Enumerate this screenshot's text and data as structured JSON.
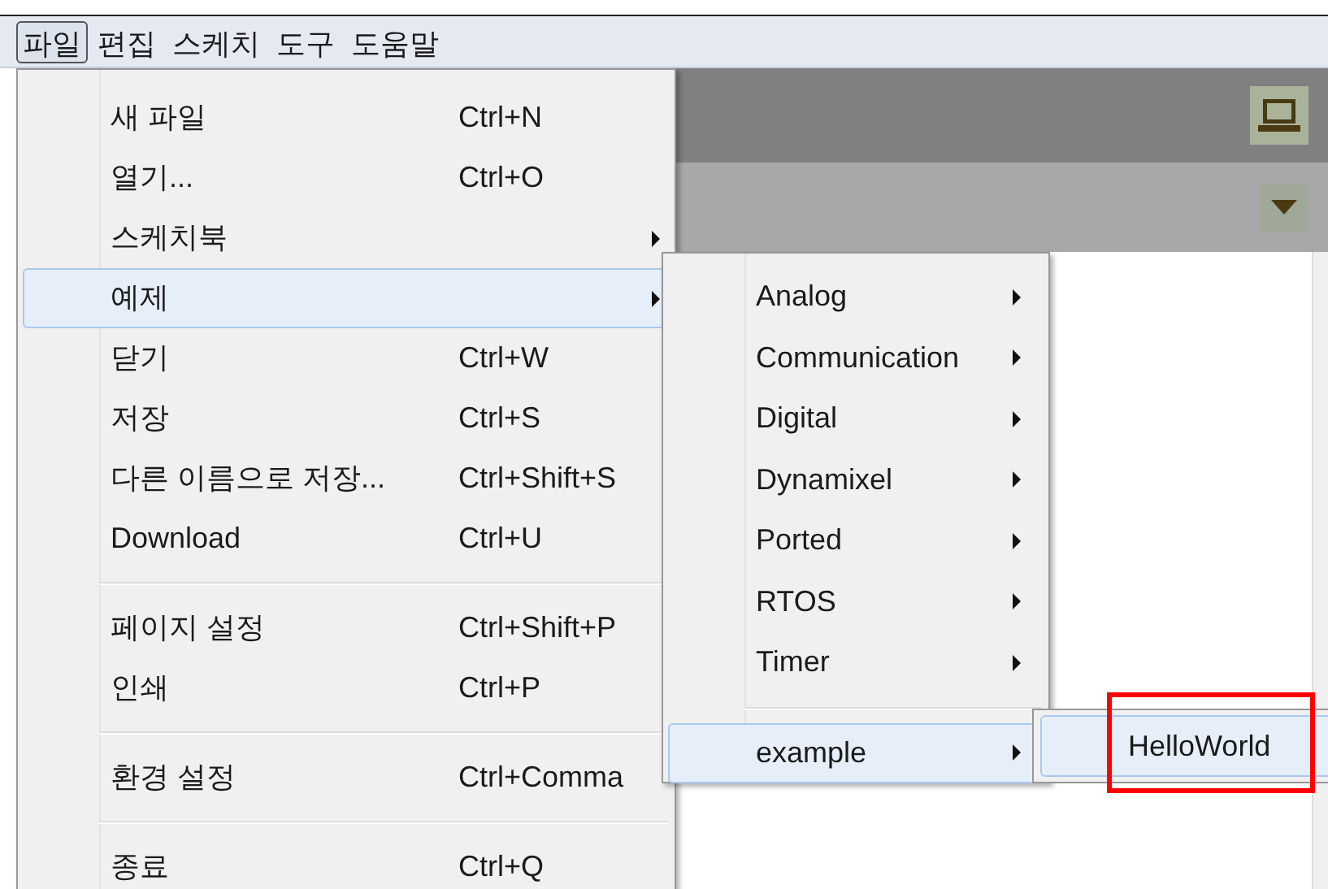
{
  "menubar": [
    {
      "label": "파일",
      "selected": true
    },
    {
      "label": "편집",
      "selected": false
    },
    {
      "label": "스케치",
      "selected": false
    },
    {
      "label": "도구",
      "selected": false
    },
    {
      "label": "도움말",
      "selected": false
    }
  ],
  "file_menu": [
    {
      "kind": "item",
      "label": "새 파일",
      "shortcut": "Ctrl+N",
      "has_submenu": false,
      "selected": false
    },
    {
      "kind": "item",
      "label": "열기...",
      "shortcut": "Ctrl+O",
      "has_submenu": false,
      "selected": false
    },
    {
      "kind": "item",
      "label": "스케치북",
      "has_submenu": true,
      "selected": false
    },
    {
      "kind": "item",
      "label": "예제",
      "has_submenu": true,
      "selected": true
    },
    {
      "kind": "item",
      "label": "닫기",
      "shortcut": "Ctrl+W",
      "has_submenu": false,
      "selected": false
    },
    {
      "kind": "item",
      "label": "저장",
      "shortcut": "Ctrl+S",
      "has_submenu": false,
      "selected": false
    },
    {
      "kind": "item",
      "label": "다른 이름으로 저장...",
      "shortcut": "Ctrl+Shift+S",
      "has_submenu": false,
      "selected": false
    },
    {
      "kind": "item",
      "label": "Download",
      "shortcut": "Ctrl+U",
      "has_submenu": false,
      "selected": false
    },
    {
      "kind": "separator"
    },
    {
      "kind": "item",
      "label": "페이지 설정",
      "shortcut": "Ctrl+Shift+P",
      "has_submenu": false,
      "selected": false
    },
    {
      "kind": "item",
      "label": "인쇄",
      "shortcut": "Ctrl+P",
      "has_submenu": false,
      "selected": false
    },
    {
      "kind": "separator"
    },
    {
      "kind": "item",
      "label": "환경 설정",
      "shortcut": "Ctrl+Comma",
      "has_submenu": false,
      "selected": false
    },
    {
      "kind": "separator"
    },
    {
      "kind": "item",
      "label": "종료",
      "shortcut": "Ctrl+Q",
      "has_submenu": false,
      "selected": false
    }
  ],
  "examples_menu": [
    {
      "kind": "item",
      "label": "Analog",
      "has_submenu": true,
      "selected": false
    },
    {
      "kind": "item",
      "label": "Communication",
      "has_submenu": true,
      "selected": false
    },
    {
      "kind": "item",
      "label": "Digital",
      "has_submenu": true,
      "selected": false
    },
    {
      "kind": "item",
      "label": "Dynamixel",
      "has_submenu": true,
      "selected": false
    },
    {
      "kind": "item",
      "label": "Ported",
      "has_submenu": true,
      "selected": false
    },
    {
      "kind": "item",
      "label": "RTOS",
      "has_submenu": true,
      "selected": false
    },
    {
      "kind": "item",
      "label": "Timer",
      "has_submenu": true,
      "selected": false
    },
    {
      "kind": "separator"
    },
    {
      "kind": "item",
      "label": "example",
      "has_submenu": true,
      "selected": true
    }
  ],
  "example_menu": [
    {
      "label": "HelloWorld",
      "selected": true,
      "highlighted": true
    }
  ]
}
